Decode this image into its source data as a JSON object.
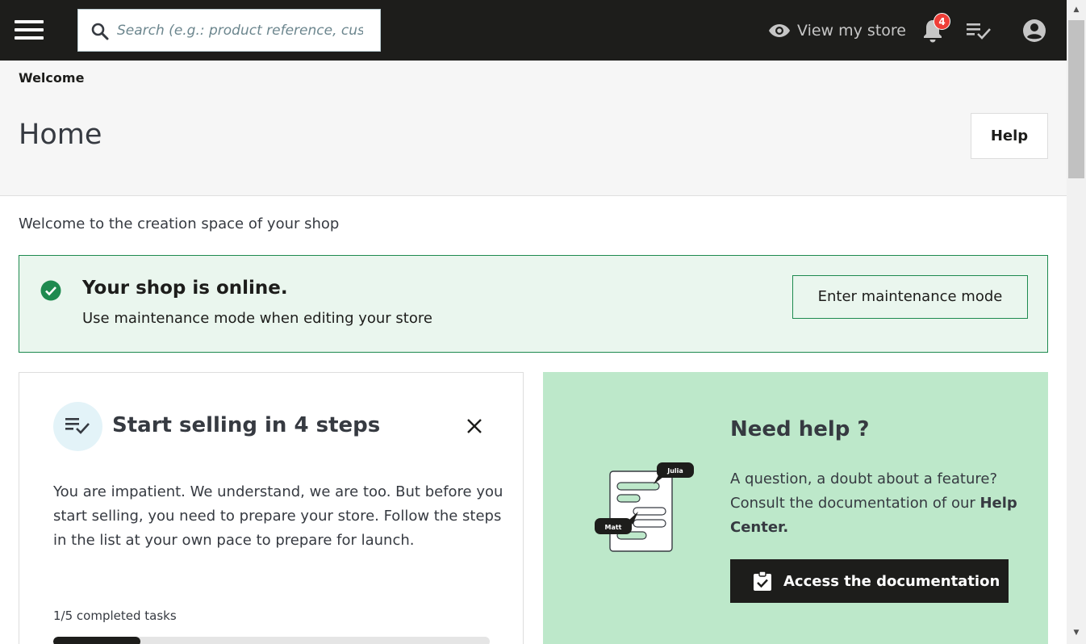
{
  "topbar": {
    "search_placeholder": "Search (e.g.: product reference, custom",
    "view_store_label": "View my store",
    "notifications_count": "4",
    "icons": {
      "menu": "hamburger-menu-icon",
      "search": "search-icon",
      "view_store": "eye-icon",
      "notifications": "bell-icon",
      "tasks": "checklist-icon",
      "account": "account-circle-icon"
    }
  },
  "header": {
    "breadcrumb": "Welcome",
    "title": "Home",
    "help_label": "Help"
  },
  "main": {
    "intro": "Welcome to the creation space of your shop"
  },
  "alert": {
    "title": "Your shop is online.",
    "subtitle": "Use maintenance mode when editing your store",
    "button_label": "Enter maintenance mode",
    "icon": "check-circle-icon"
  },
  "onboarding": {
    "title": "Start selling in 4 steps",
    "description": "You are impatient. We understand, we are too. But before you start selling, you need to prepare your store. Follow the steps in the list at your own pace to prepare for launch.",
    "progress_label": "1/5 completed tasks",
    "progress_fraction": 0.2
  },
  "help_card": {
    "title": "Need help ?",
    "description_prefix": "A question, a doubt about a feature? Consult the documentation of our ",
    "description_link": "Help Center.",
    "button_label": "Access the documentation",
    "illustration_names": [
      "Julia",
      "Matt"
    ]
  },
  "colors": {
    "topbar_bg": "#1d1d1b",
    "success_border": "#1e8a4f",
    "success_bg": "#eaf6ee",
    "help_card_bg": "#bde8ca",
    "badge_red": "#ee3e38"
  }
}
